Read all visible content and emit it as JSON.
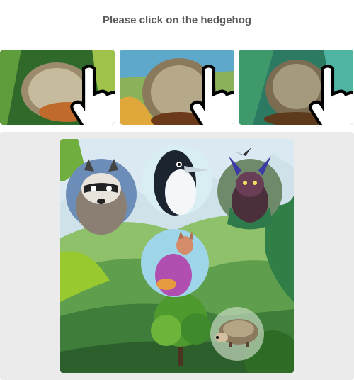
{
  "captcha": {
    "instruction": "Please click on the hedgehog",
    "examples": [
      {
        "subject": "hedgehog",
        "icon": "hand-cursor-icon"
      },
      {
        "subject": "hedgehog",
        "icon": "hand-cursor-icon"
      },
      {
        "subject": "hedgehog",
        "icon": "hand-cursor-icon"
      }
    ],
    "challenge_animals": [
      "raccoon",
      "penguin",
      "bat",
      "cat",
      "hedgehog"
    ]
  }
}
